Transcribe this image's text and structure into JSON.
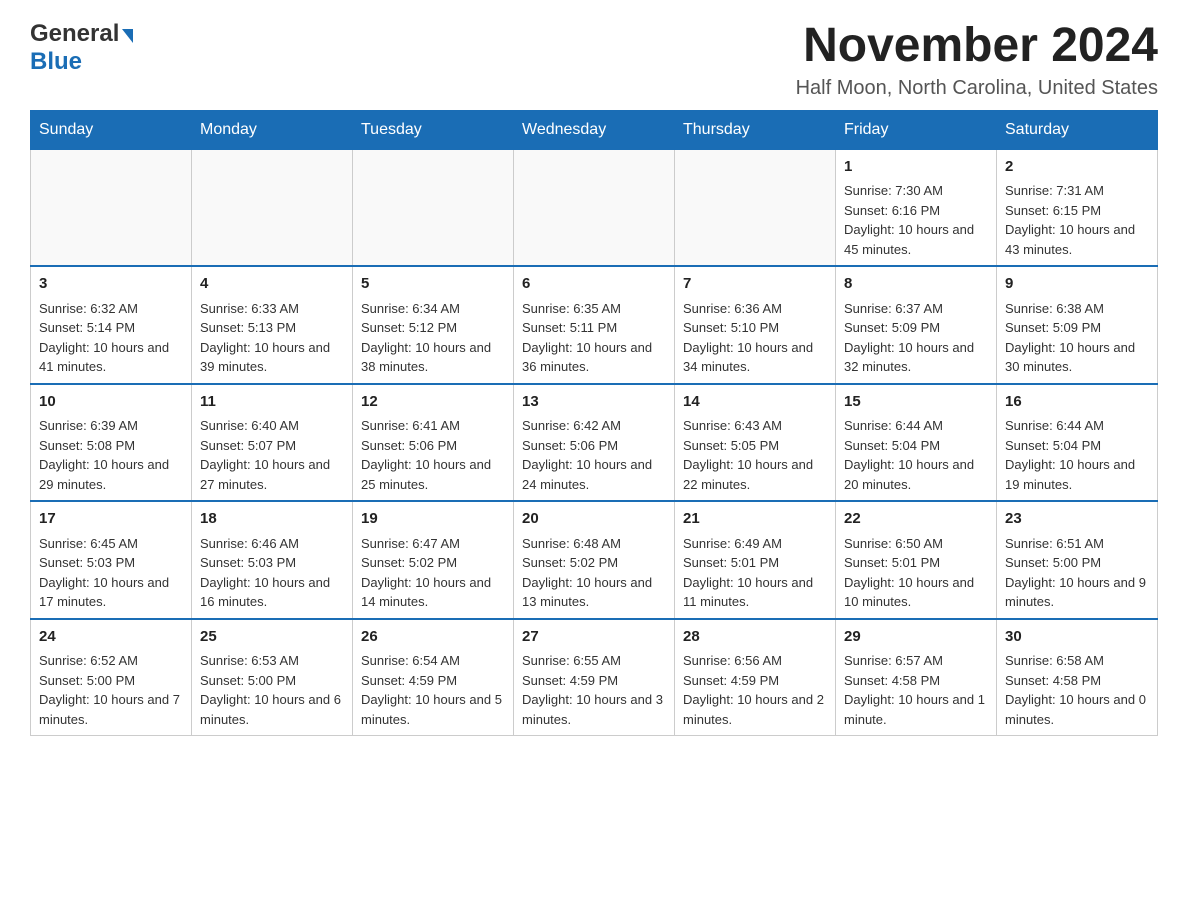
{
  "header": {
    "logo_line1": "General",
    "logo_line2": "Blue",
    "month": "November 2024",
    "location": "Half Moon, North Carolina, United States"
  },
  "weekdays": [
    "Sunday",
    "Monday",
    "Tuesday",
    "Wednesday",
    "Thursday",
    "Friday",
    "Saturday"
  ],
  "weeks": [
    [
      {
        "day": "",
        "info": ""
      },
      {
        "day": "",
        "info": ""
      },
      {
        "day": "",
        "info": ""
      },
      {
        "day": "",
        "info": ""
      },
      {
        "day": "",
        "info": ""
      },
      {
        "day": "1",
        "info": "Sunrise: 7:30 AM\nSunset: 6:16 PM\nDaylight: 10 hours and 45 minutes."
      },
      {
        "day": "2",
        "info": "Sunrise: 7:31 AM\nSunset: 6:15 PM\nDaylight: 10 hours and 43 minutes."
      }
    ],
    [
      {
        "day": "3",
        "info": "Sunrise: 6:32 AM\nSunset: 5:14 PM\nDaylight: 10 hours and 41 minutes."
      },
      {
        "day": "4",
        "info": "Sunrise: 6:33 AM\nSunset: 5:13 PM\nDaylight: 10 hours and 39 minutes."
      },
      {
        "day": "5",
        "info": "Sunrise: 6:34 AM\nSunset: 5:12 PM\nDaylight: 10 hours and 38 minutes."
      },
      {
        "day": "6",
        "info": "Sunrise: 6:35 AM\nSunset: 5:11 PM\nDaylight: 10 hours and 36 minutes."
      },
      {
        "day": "7",
        "info": "Sunrise: 6:36 AM\nSunset: 5:10 PM\nDaylight: 10 hours and 34 minutes."
      },
      {
        "day": "8",
        "info": "Sunrise: 6:37 AM\nSunset: 5:09 PM\nDaylight: 10 hours and 32 minutes."
      },
      {
        "day": "9",
        "info": "Sunrise: 6:38 AM\nSunset: 5:09 PM\nDaylight: 10 hours and 30 minutes."
      }
    ],
    [
      {
        "day": "10",
        "info": "Sunrise: 6:39 AM\nSunset: 5:08 PM\nDaylight: 10 hours and 29 minutes."
      },
      {
        "day": "11",
        "info": "Sunrise: 6:40 AM\nSunset: 5:07 PM\nDaylight: 10 hours and 27 minutes."
      },
      {
        "day": "12",
        "info": "Sunrise: 6:41 AM\nSunset: 5:06 PM\nDaylight: 10 hours and 25 minutes."
      },
      {
        "day": "13",
        "info": "Sunrise: 6:42 AM\nSunset: 5:06 PM\nDaylight: 10 hours and 24 minutes."
      },
      {
        "day": "14",
        "info": "Sunrise: 6:43 AM\nSunset: 5:05 PM\nDaylight: 10 hours and 22 minutes."
      },
      {
        "day": "15",
        "info": "Sunrise: 6:44 AM\nSunset: 5:04 PM\nDaylight: 10 hours and 20 minutes."
      },
      {
        "day": "16",
        "info": "Sunrise: 6:44 AM\nSunset: 5:04 PM\nDaylight: 10 hours and 19 minutes."
      }
    ],
    [
      {
        "day": "17",
        "info": "Sunrise: 6:45 AM\nSunset: 5:03 PM\nDaylight: 10 hours and 17 minutes."
      },
      {
        "day": "18",
        "info": "Sunrise: 6:46 AM\nSunset: 5:03 PM\nDaylight: 10 hours and 16 minutes."
      },
      {
        "day": "19",
        "info": "Sunrise: 6:47 AM\nSunset: 5:02 PM\nDaylight: 10 hours and 14 minutes."
      },
      {
        "day": "20",
        "info": "Sunrise: 6:48 AM\nSunset: 5:02 PM\nDaylight: 10 hours and 13 minutes."
      },
      {
        "day": "21",
        "info": "Sunrise: 6:49 AM\nSunset: 5:01 PM\nDaylight: 10 hours and 11 minutes."
      },
      {
        "day": "22",
        "info": "Sunrise: 6:50 AM\nSunset: 5:01 PM\nDaylight: 10 hours and 10 minutes."
      },
      {
        "day": "23",
        "info": "Sunrise: 6:51 AM\nSunset: 5:00 PM\nDaylight: 10 hours and 9 minutes."
      }
    ],
    [
      {
        "day": "24",
        "info": "Sunrise: 6:52 AM\nSunset: 5:00 PM\nDaylight: 10 hours and 7 minutes."
      },
      {
        "day": "25",
        "info": "Sunrise: 6:53 AM\nSunset: 5:00 PM\nDaylight: 10 hours and 6 minutes."
      },
      {
        "day": "26",
        "info": "Sunrise: 6:54 AM\nSunset: 4:59 PM\nDaylight: 10 hours and 5 minutes."
      },
      {
        "day": "27",
        "info": "Sunrise: 6:55 AM\nSunset: 4:59 PM\nDaylight: 10 hours and 3 minutes."
      },
      {
        "day": "28",
        "info": "Sunrise: 6:56 AM\nSunset: 4:59 PM\nDaylight: 10 hours and 2 minutes."
      },
      {
        "day": "29",
        "info": "Sunrise: 6:57 AM\nSunset: 4:58 PM\nDaylight: 10 hours and 1 minute."
      },
      {
        "day": "30",
        "info": "Sunrise: 6:58 AM\nSunset: 4:58 PM\nDaylight: 10 hours and 0 minutes."
      }
    ]
  ]
}
